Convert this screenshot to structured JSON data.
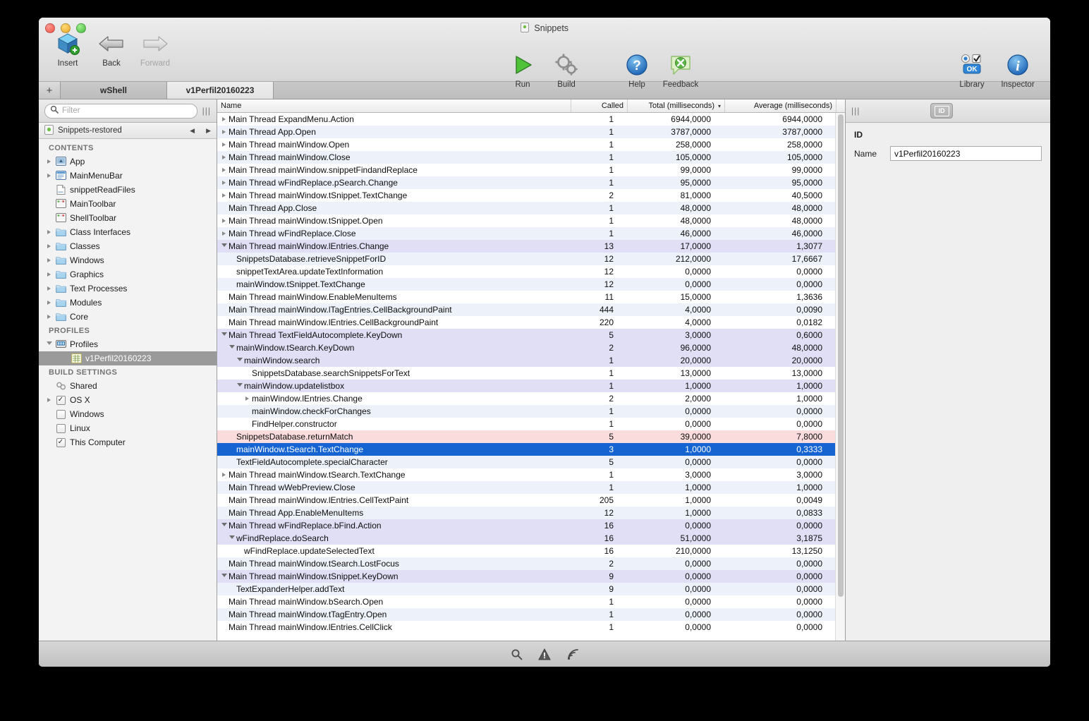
{
  "window": {
    "doc_title": "Snippets",
    "traffic_lights": [
      "close",
      "minimize",
      "zoom"
    ]
  },
  "toolbar": {
    "left_buttons": [
      {
        "label": "Insert",
        "icon": "insert-cube-icon",
        "disabled": false
      },
      {
        "label": "Back",
        "icon": "back-arrow-icon",
        "disabled": false
      },
      {
        "label": "Forward",
        "icon": "forward-arrow-icon",
        "disabled": true
      }
    ],
    "center_buttons": [
      {
        "label": "Run",
        "icon": "play-triangle-icon"
      },
      {
        "label": "Build",
        "icon": "gears-icon"
      },
      {
        "label": "Help",
        "icon": "help-question-icon"
      },
      {
        "label": "Feedback",
        "icon": "feedback-bubble-icon"
      }
    ],
    "right_buttons": [
      {
        "label": "Library",
        "icon": "library-controls-icon"
      },
      {
        "label": "Inspector",
        "icon": "info-circle-icon"
      }
    ]
  },
  "tabbar": {
    "add_label": "+",
    "tabs": [
      {
        "label": "wShell",
        "active": false
      },
      {
        "label": "v1Perfil20160223",
        "active": true
      }
    ]
  },
  "sidebar": {
    "filter_placeholder": "Filter",
    "project_name": "Snippets-restored",
    "nav_back": "◀",
    "nav_forward": "▶",
    "sections": [
      {
        "title": "CONTENTS",
        "items": [
          {
            "label": "App",
            "icon": "app-window-icon",
            "twisty": "right",
            "indent": 0
          },
          {
            "label": "MainMenuBar",
            "icon": "menubar-icon",
            "twisty": "right",
            "indent": 0
          },
          {
            "label": "snippetReadFiles",
            "icon": "document-icon",
            "twisty": "none",
            "indent": 0
          },
          {
            "label": "MainToolbar",
            "icon": "toolbar-icon",
            "twisty": "none",
            "indent": 0
          },
          {
            "label": "ShellToolbar",
            "icon": "toolbar-icon",
            "twisty": "none",
            "indent": 0
          },
          {
            "label": "Class Interfaces",
            "icon": "folder-icon",
            "twisty": "right",
            "indent": 0
          },
          {
            "label": "Classes",
            "icon": "folder-icon",
            "twisty": "right",
            "indent": 0
          },
          {
            "label": "Windows",
            "icon": "folder-icon",
            "twisty": "right",
            "indent": 0
          },
          {
            "label": "Graphics",
            "icon": "folder-icon",
            "twisty": "right",
            "indent": 0
          },
          {
            "label": "Text Processes",
            "icon": "folder-icon",
            "twisty": "right",
            "indent": 0
          },
          {
            "label": "Modules",
            "icon": "folder-icon",
            "twisty": "right",
            "indent": 0
          },
          {
            "label": "Core",
            "icon": "folder-icon",
            "twisty": "right",
            "indent": 0
          }
        ]
      },
      {
        "title": "PROFILES",
        "items": [
          {
            "label": "Profiles",
            "icon": "profiles-icon",
            "twisty": "down",
            "indent": 0
          },
          {
            "label": "v1Perfil20160223",
            "icon": "profile-sheet-icon",
            "twisty": "none",
            "indent": 1,
            "selected": true
          }
        ]
      },
      {
        "title": "BUILD SETTINGS",
        "items": [
          {
            "label": "Shared",
            "icon": "shared-link-icon",
            "twisty": "none",
            "indent": 0
          },
          {
            "label": "OS X",
            "icon": "checkbox-checked",
            "twisty": "right",
            "indent": 0
          },
          {
            "label": "Windows",
            "icon": "checkbox-unchecked",
            "twisty": "none",
            "indent": 0
          },
          {
            "label": "Linux",
            "icon": "checkbox-unchecked",
            "twisty": "none",
            "indent": 0
          },
          {
            "label": "This Computer",
            "icon": "checkbox-checked",
            "twisty": "none",
            "indent": 0
          }
        ]
      }
    ]
  },
  "table": {
    "columns": [
      {
        "key": "name",
        "label": "Name",
        "align": "left"
      },
      {
        "key": "called",
        "label": "Called",
        "align": "right"
      },
      {
        "key": "total",
        "label": "Total (milliseconds)",
        "align": "right",
        "sorted": true,
        "sort_caret": "▾"
      },
      {
        "key": "average",
        "label": "Average (milliseconds)",
        "align": "right"
      }
    ],
    "rows": [
      {
        "name": "Main Thread ExpandMenu.Action",
        "called": "1",
        "total": "6944,0000",
        "average": "6944,0000",
        "indent": 0,
        "twisty": "right",
        "style": "even"
      },
      {
        "name": "Main Thread App.Open",
        "called": "1",
        "total": "3787,0000",
        "average": "3787,0000",
        "indent": 0,
        "twisty": "right",
        "style": "odd"
      },
      {
        "name": "Main Thread mainWindow.Open",
        "called": "1",
        "total": "258,0000",
        "average": "258,0000",
        "indent": 0,
        "twisty": "right",
        "style": "even"
      },
      {
        "name": "Main Thread mainWindow.Close",
        "called": "1",
        "total": "105,0000",
        "average": "105,0000",
        "indent": 0,
        "twisty": "right",
        "style": "odd"
      },
      {
        "name": "Main Thread mainWindow.snippetFindandReplace",
        "called": "1",
        "total": "99,0000",
        "average": "99,0000",
        "indent": 0,
        "twisty": "right",
        "style": "even"
      },
      {
        "name": "Main Thread wFindReplace.pSearch.Change",
        "called": "1",
        "total": "95,0000",
        "average": "95,0000",
        "indent": 0,
        "twisty": "right",
        "style": "odd"
      },
      {
        "name": "Main Thread mainWindow.tSnippet.TextChange",
        "called": "2",
        "total": "81,0000",
        "average": "40,5000",
        "indent": 0,
        "twisty": "right",
        "style": "even"
      },
      {
        "name": "Main Thread App.Close",
        "called": "1",
        "total": "48,0000",
        "average": "48,0000",
        "indent": 0,
        "twisty": "none",
        "style": "odd"
      },
      {
        "name": "Main Thread mainWindow.tSnippet.Open",
        "called": "1",
        "total": "48,0000",
        "average": "48,0000",
        "indent": 0,
        "twisty": "right",
        "style": "even"
      },
      {
        "name": "Main Thread wFindReplace.Close",
        "called": "1",
        "total": "46,0000",
        "average": "46,0000",
        "indent": 0,
        "twisty": "right",
        "style": "odd"
      },
      {
        "name": "Main Thread mainWindow.lEntries.Change",
        "called": "13",
        "total": "17,0000",
        "average": "1,3077",
        "indent": 0,
        "twisty": "down",
        "style": "group"
      },
      {
        "name": "SnippetsDatabase.retrieveSnippetForID",
        "called": "12",
        "total": "212,0000",
        "average": "17,6667",
        "indent": 1,
        "twisty": "none",
        "style": "odd"
      },
      {
        "name": "snippetTextArea.updateTextInformation",
        "called": "12",
        "total": "0,0000",
        "average": "0,0000",
        "indent": 1,
        "twisty": "none",
        "style": "even"
      },
      {
        "name": "mainWindow.tSnippet.TextChange",
        "called": "12",
        "total": "0,0000",
        "average": "0,0000",
        "indent": 1,
        "twisty": "none",
        "style": "odd"
      },
      {
        "name": "Main Thread mainWindow.EnableMenuItems",
        "called": "11",
        "total": "15,0000",
        "average": "1,3636",
        "indent": 0,
        "twisty": "none",
        "style": "even"
      },
      {
        "name": "Main Thread mainWindow.lTagEntries.CellBackgroundPaint",
        "called": "444",
        "total": "4,0000",
        "average": "0,0090",
        "indent": 0,
        "twisty": "none",
        "style": "odd"
      },
      {
        "name": "Main Thread mainWindow.lEntries.CellBackgroundPaint",
        "called": "220",
        "total": "4,0000",
        "average": "0,0182",
        "indent": 0,
        "twisty": "none",
        "style": "even"
      },
      {
        "name": "Main Thread TextFieldAutocomplete.KeyDown",
        "called": "5",
        "total": "3,0000",
        "average": "0,6000",
        "indent": 0,
        "twisty": "down",
        "style": "group"
      },
      {
        "name": "mainWindow.tSearch.KeyDown",
        "called": "2",
        "total": "96,0000",
        "average": "48,0000",
        "indent": 1,
        "twisty": "down",
        "style": "group"
      },
      {
        "name": "mainWindow.search",
        "called": "1",
        "total": "20,0000",
        "average": "20,0000",
        "indent": 2,
        "twisty": "down",
        "style": "group"
      },
      {
        "name": "SnippetsDatabase.searchSnippetsForText",
        "called": "1",
        "total": "13,0000",
        "average": "13,0000",
        "indent": 3,
        "twisty": "none",
        "style": "even"
      },
      {
        "name": "mainWindow.updatelistbox",
        "called": "1",
        "total": "1,0000",
        "average": "1,0000",
        "indent": 2,
        "twisty": "down",
        "style": "group"
      },
      {
        "name": "mainWindow.lEntries.Change",
        "called": "2",
        "total": "2,0000",
        "average": "1,0000",
        "indent": 3,
        "twisty": "right",
        "style": "even"
      },
      {
        "name": "mainWindow.checkForChanges",
        "called": "1",
        "total": "0,0000",
        "average": "0,0000",
        "indent": 3,
        "twisty": "none",
        "style": "odd"
      },
      {
        "name": "FindHelper.constructor",
        "called": "1",
        "total": "0,0000",
        "average": "0,0000",
        "indent": 3,
        "twisty": "none",
        "style": "even"
      },
      {
        "name": "SnippetsDatabase.returnMatch",
        "called": "5",
        "total": "39,0000",
        "average": "7,8000",
        "indent": 1,
        "twisty": "none",
        "style": "pink"
      },
      {
        "name": "mainWindow.tSearch.TextChange",
        "called": "3",
        "total": "1,0000",
        "average": "0,3333",
        "indent": 1,
        "twisty": "none",
        "style": "sel"
      },
      {
        "name": "TextFieldAutocomplete.specialCharacter",
        "called": "5",
        "total": "0,0000",
        "average": "0,0000",
        "indent": 1,
        "twisty": "none",
        "style": "odd"
      },
      {
        "name": "Main Thread mainWindow.tSearch.TextChange",
        "called": "1",
        "total": "3,0000",
        "average": "3,0000",
        "indent": 0,
        "twisty": "right",
        "style": "even"
      },
      {
        "name": "Main Thread wWebPreview.Close",
        "called": "1",
        "total": "1,0000",
        "average": "1,0000",
        "indent": 0,
        "twisty": "none",
        "style": "odd"
      },
      {
        "name": "Main Thread mainWindow.lEntries.CellTextPaint",
        "called": "205",
        "total": "1,0000",
        "average": "0,0049",
        "indent": 0,
        "twisty": "none",
        "style": "even"
      },
      {
        "name": "Main Thread App.EnableMenuItems",
        "called": "12",
        "total": "1,0000",
        "average": "0,0833",
        "indent": 0,
        "twisty": "none",
        "style": "odd"
      },
      {
        "name": "Main Thread wFindReplace.bFind.Action",
        "called": "16",
        "total": "0,0000",
        "average": "0,0000",
        "indent": 0,
        "twisty": "down",
        "style": "group"
      },
      {
        "name": "wFindReplace.doSearch",
        "called": "16",
        "total": "51,0000",
        "average": "3,1875",
        "indent": 1,
        "twisty": "down",
        "style": "group"
      },
      {
        "name": "wFindReplace.updateSelectedText",
        "called": "16",
        "total": "210,0000",
        "average": "13,1250",
        "indent": 2,
        "twisty": "none",
        "style": "even"
      },
      {
        "name": "Main Thread mainWindow.tSearch.LostFocus",
        "called": "2",
        "total": "0,0000",
        "average": "0,0000",
        "indent": 0,
        "twisty": "none",
        "style": "odd"
      },
      {
        "name": "Main Thread mainWindow.tSnippet.KeyDown",
        "called": "9",
        "total": "0,0000",
        "average": "0,0000",
        "indent": 0,
        "twisty": "down",
        "style": "group"
      },
      {
        "name": "TextExpanderHelper.addText",
        "called": "9",
        "total": "0,0000",
        "average": "0,0000",
        "indent": 1,
        "twisty": "none",
        "style": "odd"
      },
      {
        "name": "Main Thread mainWindow.bSearch.Open",
        "called": "1",
        "total": "0,0000",
        "average": "0,0000",
        "indent": 0,
        "twisty": "none",
        "style": "even"
      },
      {
        "name": "Main Thread mainWindow.tTagEntry.Open",
        "called": "1",
        "total": "0,0000",
        "average": "0,0000",
        "indent": 0,
        "twisty": "none",
        "style": "odd"
      },
      {
        "name": "Main Thread mainWindow.lEntries.CellClick",
        "called": "1",
        "total": "0,0000",
        "average": "0,0000",
        "indent": 0,
        "twisty": "none",
        "style": "even"
      }
    ]
  },
  "inspector": {
    "tab_icon_label": "ID",
    "section_title": "ID",
    "name_label": "Name",
    "name_value": "v1Perfil20160223"
  },
  "statusbar": {
    "icons": [
      {
        "name": "search-icon"
      },
      {
        "name": "warning-triangle-icon"
      },
      {
        "name": "broadcast-icon"
      }
    ]
  }
}
